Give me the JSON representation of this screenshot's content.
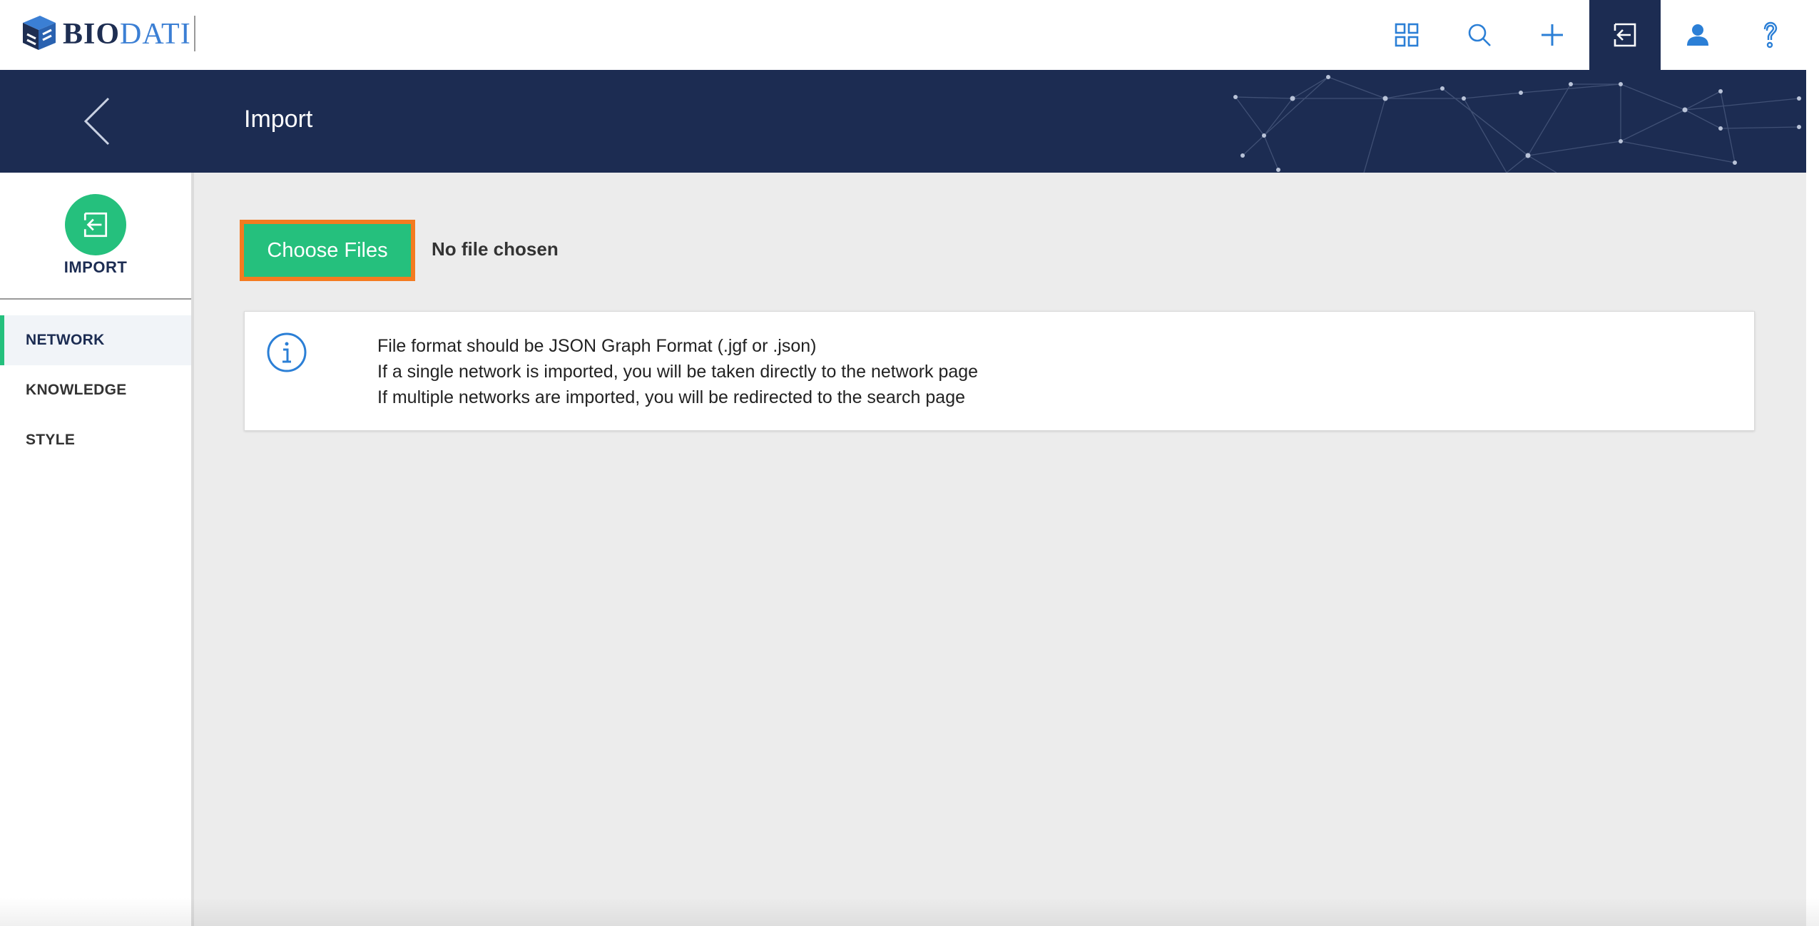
{
  "app": {
    "logo_bio": "BIO",
    "logo_dati": "DATI"
  },
  "topnav": {
    "icons": [
      {
        "name": "apps-grid-icon"
      },
      {
        "name": "search-icon"
      },
      {
        "name": "add-icon"
      },
      {
        "name": "import-icon",
        "active": true
      },
      {
        "name": "user-icon"
      },
      {
        "name": "help-icon"
      }
    ]
  },
  "header": {
    "title": "Import"
  },
  "sidebar": {
    "section_label": "IMPORT",
    "items": [
      {
        "label": "NETWORK",
        "active": true
      },
      {
        "label": "KNOWLEDGE"
      },
      {
        "label": "STYLE"
      }
    ]
  },
  "main": {
    "choose_button_label": "Choose Files",
    "file_status": "No file chosen",
    "info_lines": [
      "File format should be JSON Graph Format (.jgf or .json)",
      "If a single network is imported, you will be taken directly to the network page",
      "If multiple networks are imported, you will be redirected to the search page"
    ]
  },
  "colors": {
    "navy": "#1c2c52",
    "accent_green": "#25c07d",
    "highlight_orange": "#f47b20",
    "icon_blue": "#2b7fd6"
  }
}
